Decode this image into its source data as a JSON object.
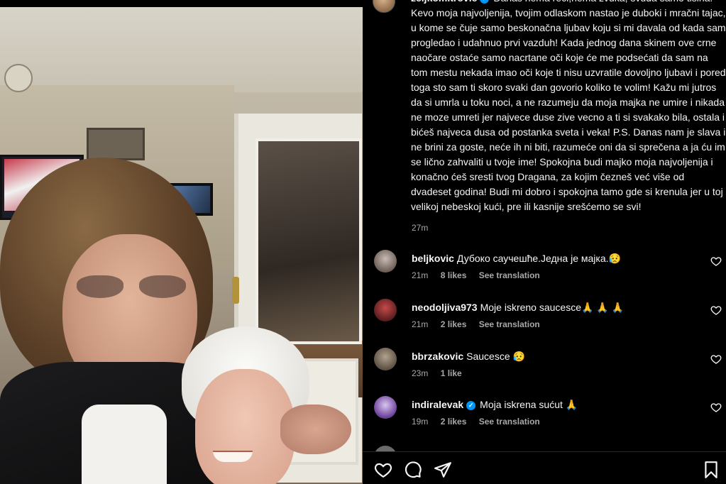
{
  "post": {
    "username": "zeljkomitrovic",
    "caption": "Danas nema reči,nema zvuka, svuda samo tišina. Kevo moja najvoljenija, tvojim odlaskom nastao je duboki i mračni tajac, u kome se čuje samo beskonačna ljubav koju si mi davala od kada sam progledao i udahnuo prvi vazduh! Kada jednog dana skinem ove crne naočare ostaće samo nacrtane oči koje će me podsećati da sam na tom mestu nekada imao oči koje ti nisu uzvratile dovoljno ljubavi i pored toga sto sam ti skoro svaki dan govorio koliko te volim! Kažu mi jutros da si umrla u toku noci, a ne razumeju da moja majka ne umire i nikada ne moze umreti jer najvece duse zive vecno a ti si svakako bila, ostala i bićeš najveca dusa od postanka sveta i veka! P.S. Danas nam je slava i ne brini za goste, neće ih ni biti, razumeće oni da si sprečena a ja ću im se lično zahvaliti u tvoje ime! Spokojna budi majko moja najvoljenija i konačno ćeš sresti tvog Dragana, za kojim čezneš već više od dvadeset godina! Budi mi dobro i spokojna tamo gde si krenula jer u toj velikoj nebeskoj kući, pre ili kasnije srešćemo se svi!",
    "time": "27m"
  },
  "comments": [
    {
      "username": "beljkovic",
      "verified": false,
      "text": "Дубоко саучешће.Једна је мајка.😥",
      "time": "21m",
      "likes": "8 likes",
      "translate": "See translation"
    },
    {
      "username": "neodoljiva973",
      "verified": false,
      "text": "Moje iskreno saucesce🙏 🙏 🙏",
      "time": "21m",
      "likes": "2 likes",
      "translate": "See translation"
    },
    {
      "username": "bbrzakovic",
      "verified": false,
      "text": "Saucesce 😥",
      "time": "23m",
      "likes": "1 like",
      "translate": ""
    },
    {
      "username": "indiralevak",
      "verified": true,
      "text": "Moja iskrena sućut 🙏",
      "time": "19m",
      "likes": "2 likes",
      "translate": "See translation"
    }
  ],
  "actions": {
    "like_icon": "heart-icon",
    "comment_icon": "comment-icon",
    "share_icon": "share-icon",
    "save_icon": "bookmark-icon"
  },
  "colors": {
    "background": "#000000",
    "text": "#f5f5f5",
    "muted": "#a8a8a8",
    "verified": "#0095f6"
  }
}
